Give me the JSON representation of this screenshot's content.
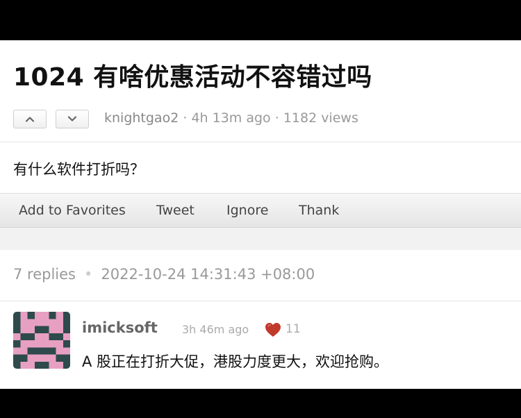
{
  "topic": {
    "title": "1024 有啥优惠活动不容错过吗",
    "author": "knightgao2",
    "age": "4h 13m ago",
    "views": "1182 views",
    "content": "有什么软件打折吗？"
  },
  "actions": {
    "favorite": "Add to Favorites",
    "tweet": "Tweet",
    "ignore": "Ignore",
    "thank": "Thank"
  },
  "replies_header": {
    "count": "7 replies",
    "timestamp": "2022-10-24 14:31:43 +08:00"
  },
  "reply": {
    "username": "imicksoft",
    "time": "3h 46m ago",
    "likes": "11",
    "content": "A 股正在打折大促，港股力度更大，欢迎抢购。"
  },
  "colors": {
    "avatar_bg": "#2e4a4d",
    "avatar_fg": "#e7a0c2",
    "heart": "#c0392b"
  },
  "icons": {
    "upvote": "chevron-up-icon",
    "downvote": "chevron-down-icon",
    "like": "heart-icon"
  }
}
